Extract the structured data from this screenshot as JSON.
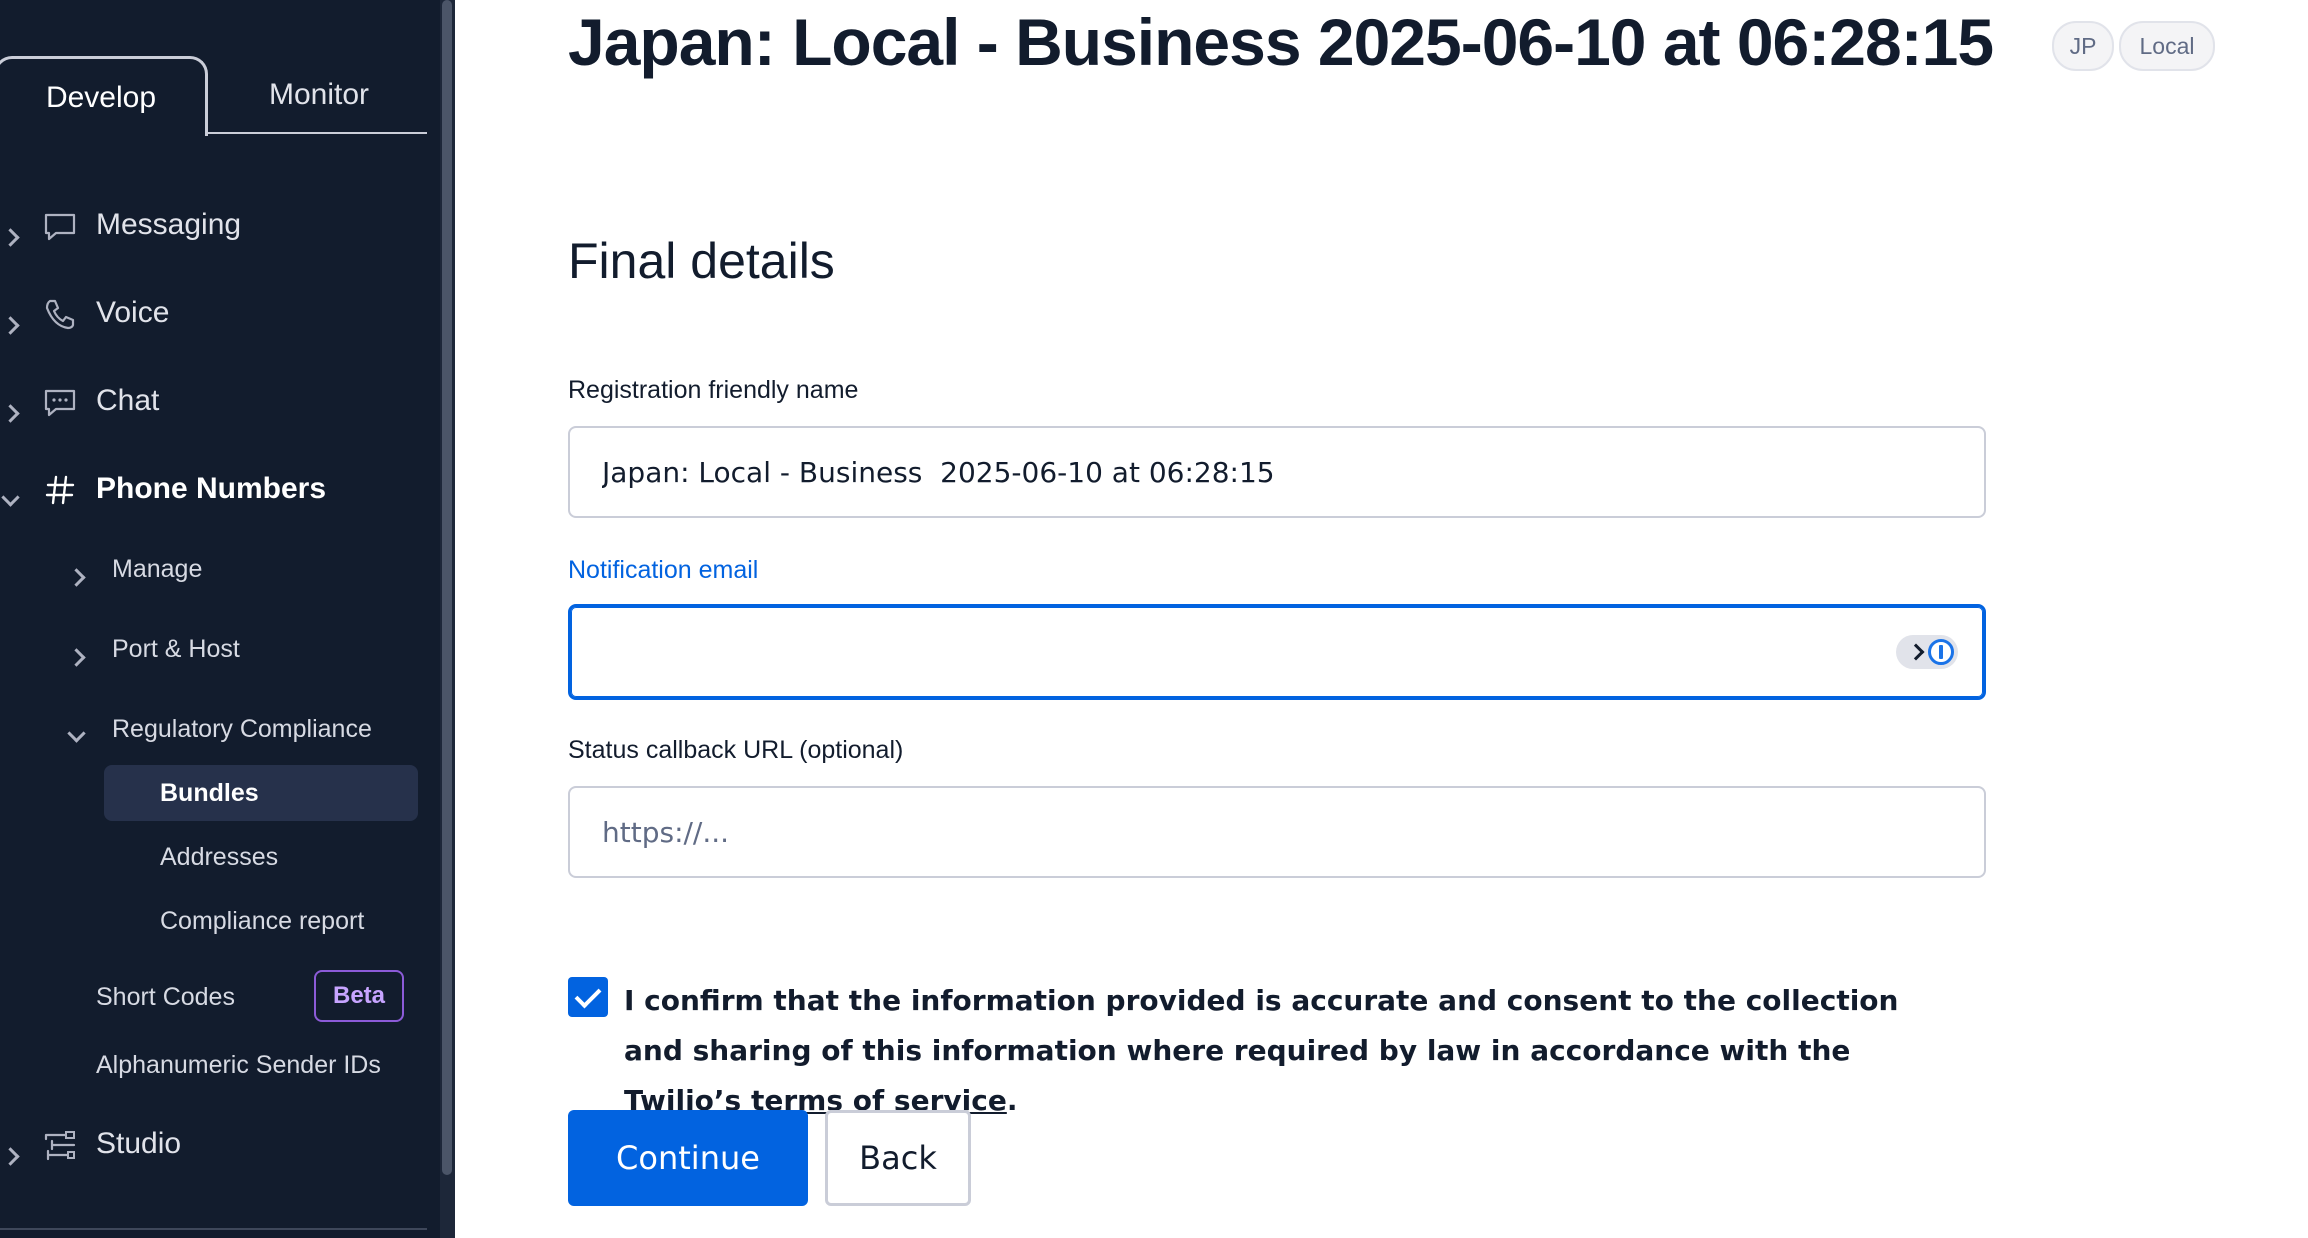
{
  "sidebar": {
    "tabs": {
      "develop": "Develop",
      "monitor": "Monitor"
    },
    "items": {
      "messaging": "Messaging",
      "voice": "Voice",
      "chat": "Chat",
      "phone_numbers": "Phone Numbers",
      "manage": "Manage",
      "port_host": "Port & Host",
      "regulatory_compliance": "Regulatory Compliance",
      "bundles": "Bundles",
      "addresses": "Addresses",
      "compliance_report": "Compliance report",
      "short_codes": "Short Codes",
      "short_codes_badge": "Beta",
      "alphanumeric_sender_ids": "Alphanumeric Sender IDs",
      "studio": "Studio"
    }
  },
  "header": {
    "title": "Japan: Local - Business 2025-06-10 at 06:28:15",
    "badges": {
      "country": "JP",
      "type": "Local"
    }
  },
  "form": {
    "section_title": "Final details",
    "friendly_name": {
      "label": "Registration friendly name",
      "value": "Japan: Local - Business  2025-06-10 at 06:28:15"
    },
    "notification_email": {
      "label": "Notification email",
      "value": ""
    },
    "status_callback": {
      "label": "Status callback URL (optional)",
      "placeholder": "https://..."
    },
    "consent": {
      "checked": true,
      "text_before": "I confirm that the information provided is accurate and consent to the collection and sharing of this information where required by law in accordance with the ",
      "link_text": "Twilio’s terms of service",
      "text_after": "."
    },
    "buttons": {
      "continue": "Continue",
      "back": "Back"
    }
  },
  "colors": {
    "sidebar_bg": "#121c2d",
    "primary": "#0263e0",
    "beta_badge": "#8c5bd8"
  }
}
